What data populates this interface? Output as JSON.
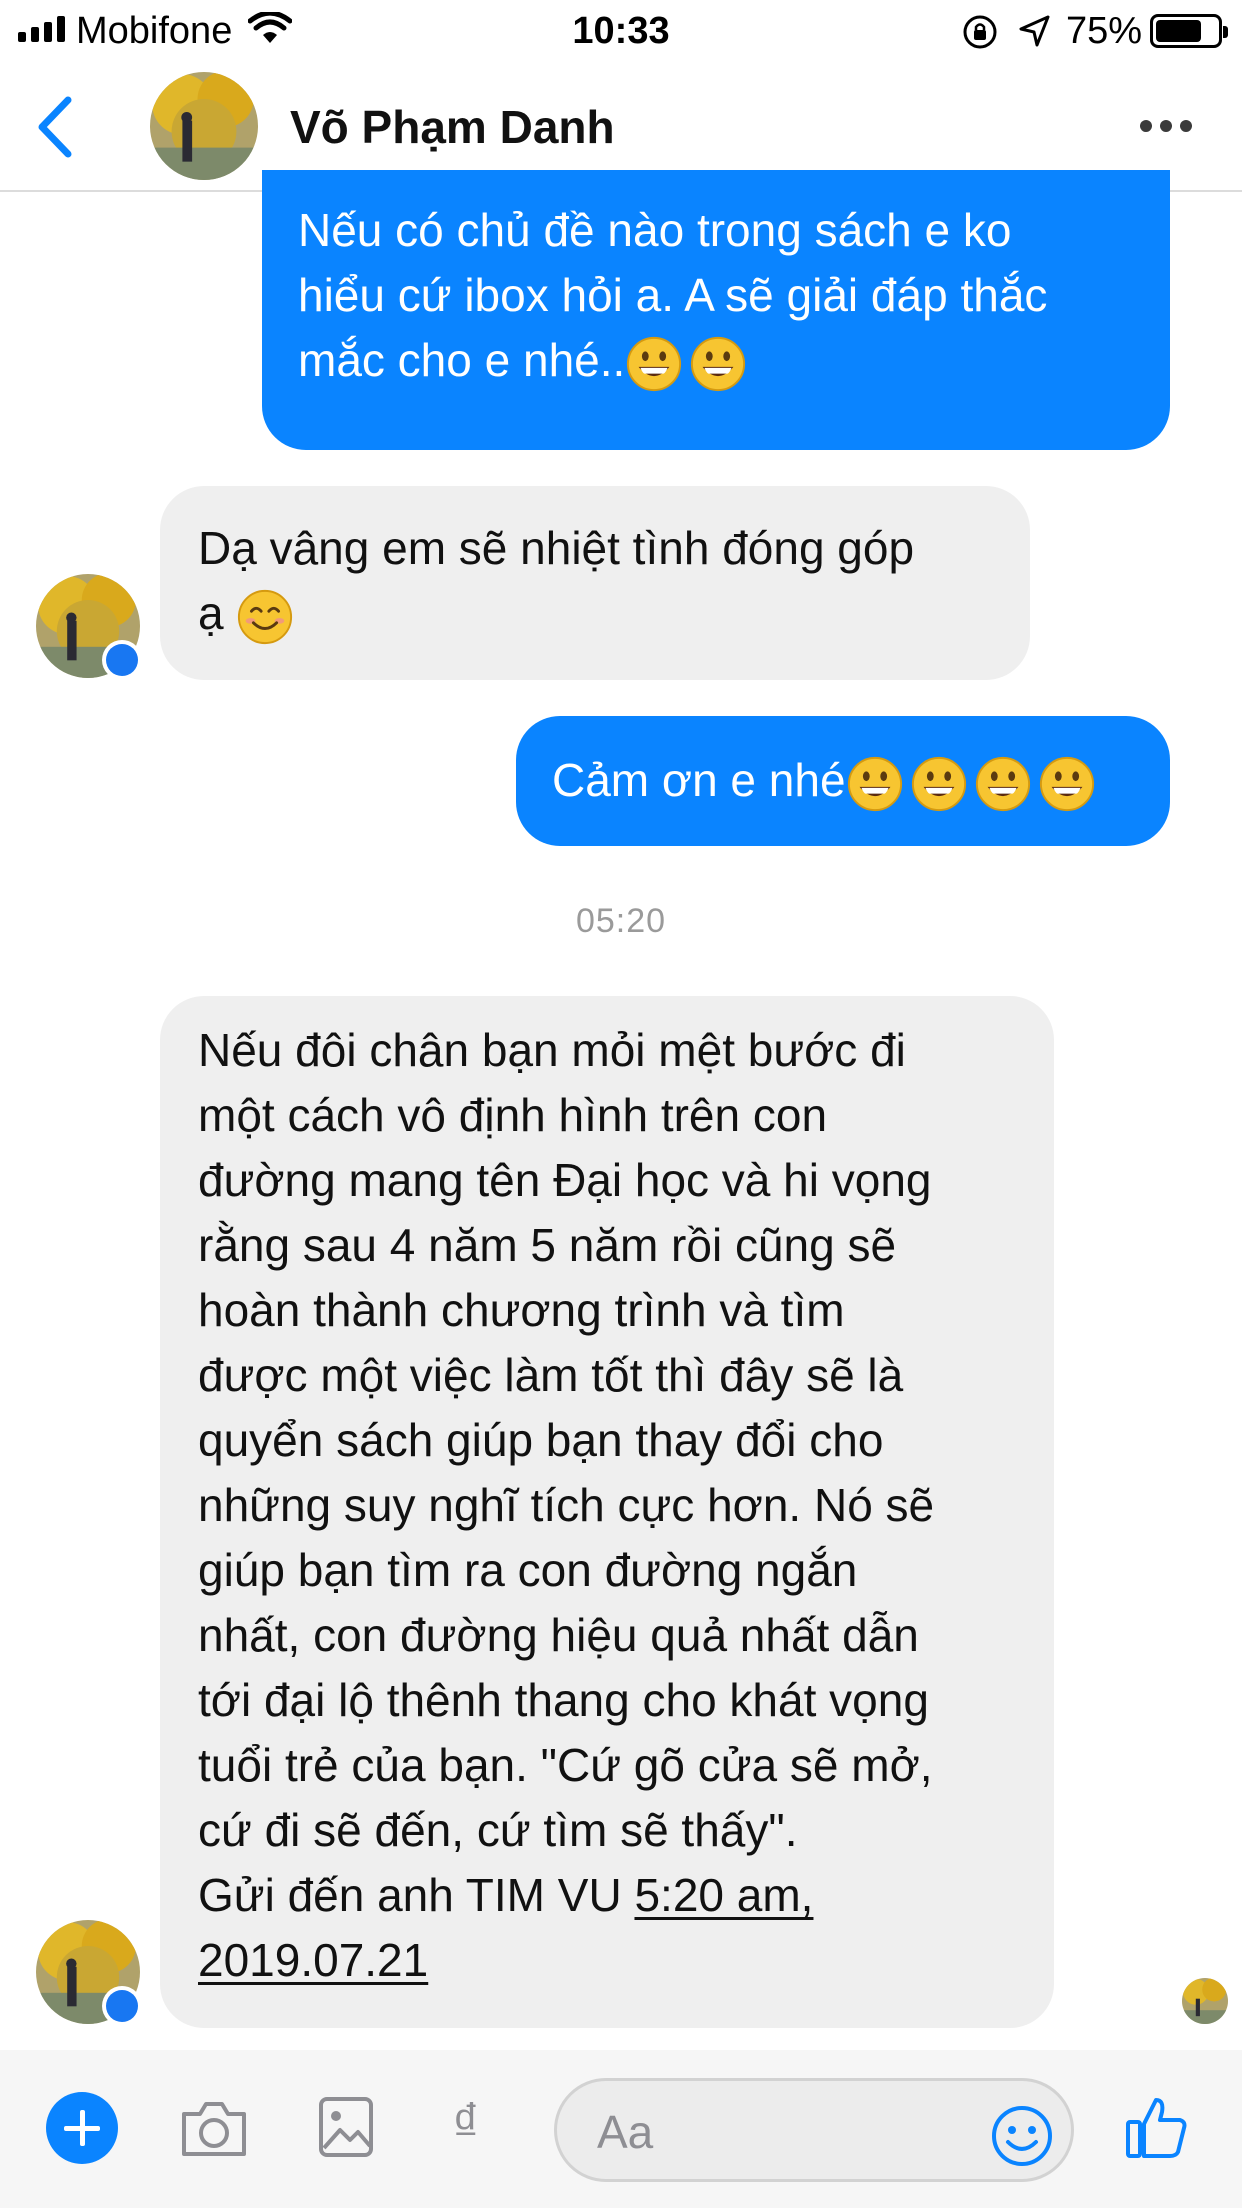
{
  "status": {
    "carrier": "Mobifone",
    "time": "10:33",
    "battery_percent": "75%",
    "battery_level": 0.75
  },
  "header": {
    "contact_name": "Võ Phạm Danh",
    "back_icon": "chevron-left-icon",
    "more_icon": "more-horizontal-icon"
  },
  "messages": [
    {
      "side": "out",
      "lines": [
        "Nếu có chủ đề  nào trong sách e ko",
        "hiểu cứ ibox hỏi a. A sẽ giải đáp thắc",
        "mắc cho e nhé.."
      ],
      "emoji": [
        "grinning-face",
        "grinning-face"
      ]
    },
    {
      "side": "in",
      "lines": [
        "Dạ vâng em sẽ nhiệt tình đóng góp",
        "ạ "
      ],
      "emoji": [
        "smiling-face"
      ]
    },
    {
      "side": "out",
      "lines": [
        "Cảm ơn e nhé"
      ],
      "emoji": [
        "grinning-face",
        "grinning-face",
        "grinning-face",
        "grinning-face"
      ]
    },
    {
      "side": "in",
      "lines": [
        "Nếu đôi chân bạn mỏi mệt bước đi",
        "một cách vô định hình trên con",
        "đường mang tên Đại học và hi vọng",
        "rằng sau 4 năm 5 năm rồi cũng sẽ",
        "hoàn thành chương trình và tìm",
        "được một việc làm tốt thì đây sẽ là",
        "quyển sách giúp bạn thay đổi cho",
        "những suy nghĩ tích cực hơn. Nó sẽ",
        "giúp bạn tìm ra con đường ngắn",
        "nhất, con đường hiệu quả nhất dẫn",
        "tới đại lộ thênh thang cho khát vọng",
        "tuổi trẻ của bạn. \"Cứ gõ cửa sẽ mở,",
        "cứ đi sẽ đến, cứ tìm sẽ thấy\".",
        "Gửi đến anh TIM VU "
      ],
      "link_line_1": "5:20 am,",
      "link_line_2": "2019.07.21"
    }
  ],
  "timestamp": "05:20",
  "composer": {
    "placeholder": "Aa",
    "currency_symbol": "₫",
    "icons": [
      "plus-icon",
      "camera-icon",
      "image-icon",
      "payment-icon",
      "emoji-icon",
      "thumbs-up-icon"
    ]
  },
  "colors": {
    "outgoing_bubble": "#0a84ff",
    "incoming_bubble": "#efefef",
    "accent": "#0a84ff"
  }
}
